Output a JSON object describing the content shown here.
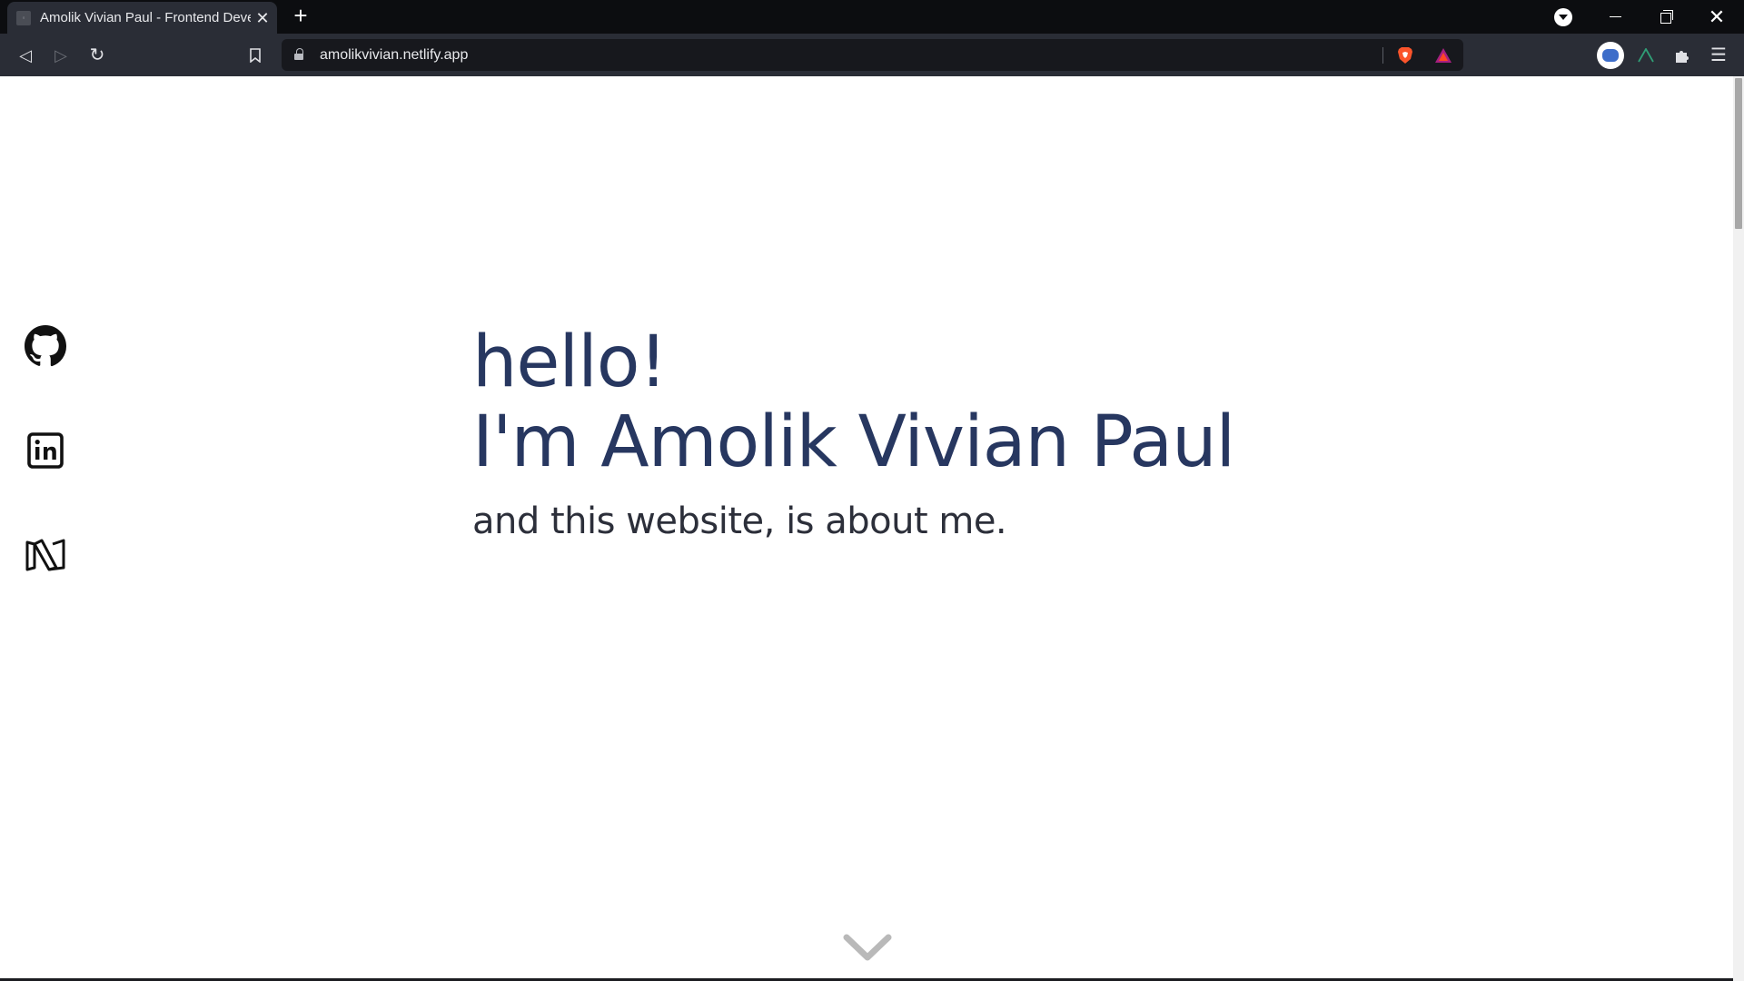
{
  "browser": {
    "tab": {
      "title": "Amolik Vivian Paul - Frontend Developer",
      "favicon_icon": "page-favicon-icon"
    },
    "new_tab_icon": "plus-icon",
    "tab_search_icon": "chevron-down-circle-icon",
    "window_controls": [
      "minimize-icon",
      "restore-icon",
      "close-icon"
    ],
    "url": "amolikvivian.netlify.app",
    "toolbar_icons": [
      "back-icon",
      "forward-icon",
      "reload-icon",
      "bookmark-icon",
      "lock-icon",
      "brave-shield-icon",
      "brave-rewards-icon",
      "profile-extension-icon",
      "vue-devtools-icon",
      "puzzle-extensions-icon",
      "hamburger-menu-icon"
    ]
  },
  "page": {
    "hero": {
      "greeting": "hello!",
      "name_line": "I'm Amolik Vivian Paul",
      "tagline": "and this website, is about me."
    },
    "social": [
      {
        "icon": "github-icon"
      },
      {
        "icon": "linkedin-icon"
      },
      {
        "icon": "medium-icon"
      }
    ],
    "scroll_indicator_icon": "chevron-down-icon",
    "colors": {
      "heading": "#273760",
      "tagline": "#2c2f3a",
      "background": "#ffffff"
    }
  }
}
